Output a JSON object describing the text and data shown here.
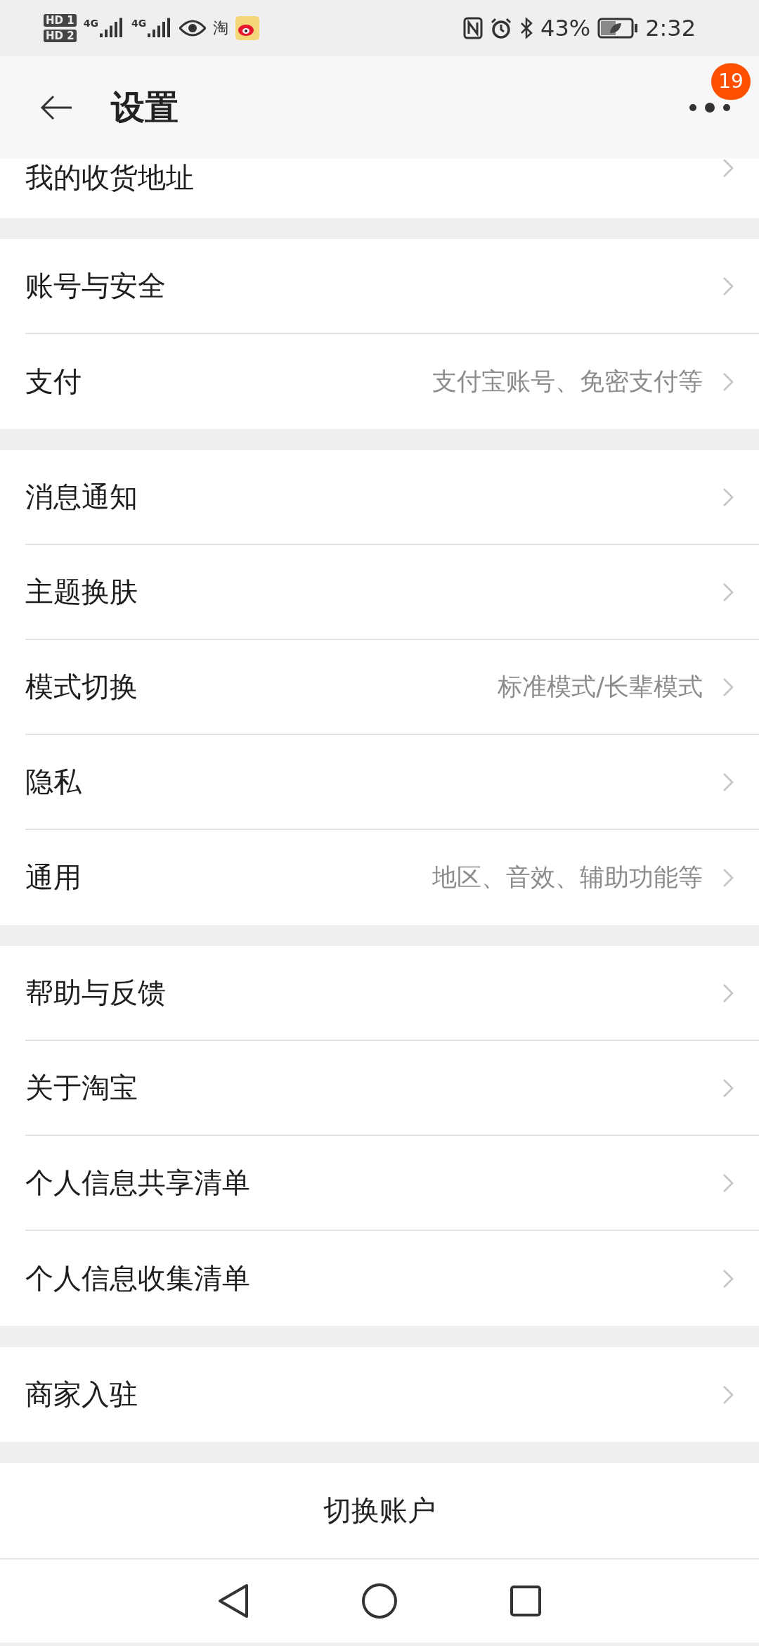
{
  "status_bar": {
    "sim_1": "HD 1",
    "sim_2": "HD 2",
    "network_1": "4G",
    "network_2": "4G",
    "app_label": "淘",
    "battery": "43%",
    "time": "2:32"
  },
  "header": {
    "title": "设置",
    "badge": "19"
  },
  "sections": [
    {
      "items": [
        {
          "label": "我的收货地址"
        }
      ]
    },
    {
      "items": [
        {
          "label": "账号与安全"
        },
        {
          "label": "支付",
          "hint": "支付宝账号、免密支付等"
        }
      ]
    },
    {
      "items": [
        {
          "label": "消息通知"
        },
        {
          "label": "主题换肤"
        },
        {
          "label": "模式切换",
          "hint": "标准模式/长辈模式"
        },
        {
          "label": "隐私"
        },
        {
          "label": "通用",
          "hint": "地区、音效、辅助功能等"
        }
      ]
    },
    {
      "items": [
        {
          "label": "帮助与反馈"
        },
        {
          "label": "关于淘宝"
        },
        {
          "label": "个人信息共享清单"
        },
        {
          "label": "个人信息收集清单"
        }
      ]
    },
    {
      "items": [
        {
          "label": "商家入驻"
        }
      ]
    }
  ],
  "switch_account": "切换账户"
}
